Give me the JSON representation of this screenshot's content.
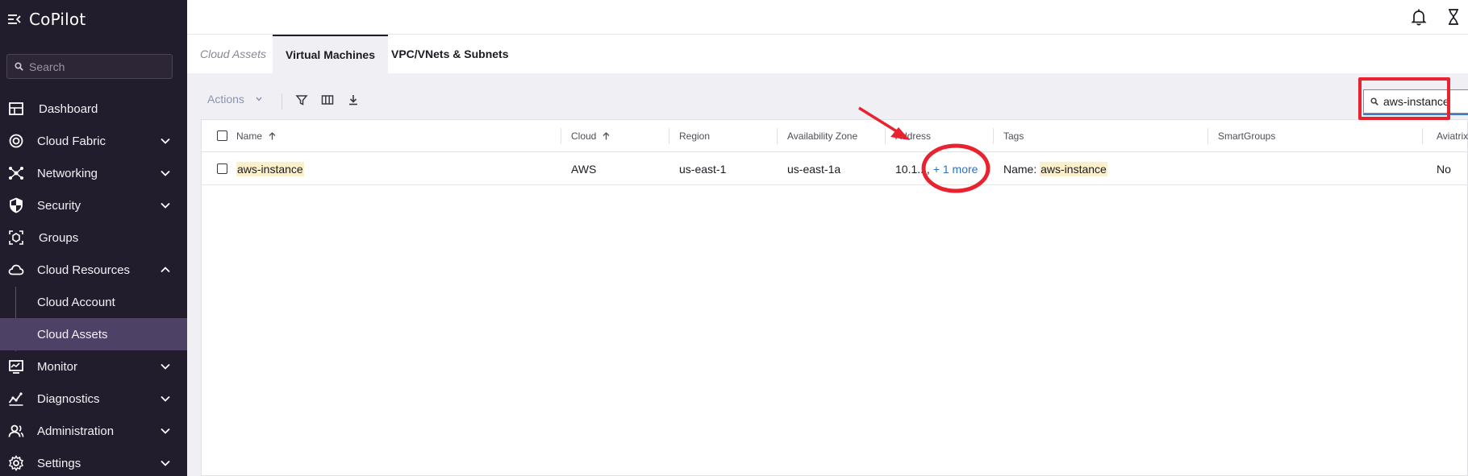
{
  "app": {
    "title": "CoPilot"
  },
  "sidebar": {
    "search_placeholder": "Search",
    "items": [
      {
        "label": "Dashboard",
        "icon": "dashboard-icon"
      },
      {
        "label": "Cloud Fabric",
        "icon": "cloud-fabric-icon",
        "expanded": false
      },
      {
        "label": "Networking",
        "icon": "networking-icon",
        "expanded": false
      },
      {
        "label": "Security",
        "icon": "shield-icon",
        "expanded": false
      },
      {
        "label": "Groups",
        "icon": "groups-icon"
      },
      {
        "label": "Cloud Resources",
        "icon": "cloud-icon",
        "expanded": true
      },
      {
        "label": "Monitor",
        "icon": "monitor-icon",
        "expanded": false
      },
      {
        "label": "Diagnostics",
        "icon": "diagnostics-icon",
        "expanded": false
      },
      {
        "label": "Administration",
        "icon": "administration-icon",
        "expanded": false
      },
      {
        "label": "Settings",
        "icon": "gear-icon",
        "expanded": false
      }
    ],
    "subitems": [
      {
        "label": "Cloud Account",
        "active": false
      },
      {
        "label": "Cloud Assets",
        "active": true
      }
    ]
  },
  "tabs": [
    {
      "label": "Cloud Assets",
      "state": "inactive"
    },
    {
      "label": "Virtual Machines",
      "state": "active"
    },
    {
      "label": "VPC/VNets & Subnets",
      "state": "normal"
    }
  ],
  "toolbar": {
    "actions_label": "Actions",
    "search_value": "aws-instance"
  },
  "table": {
    "columns": [
      "Name",
      "Cloud",
      "Region",
      "Availability Zone",
      "Address",
      "Tags",
      "SmartGroups",
      "Aviatrix"
    ],
    "rows": [
      {
        "name": "aws-instance",
        "cloud": "AWS",
        "region": "us-east-1",
        "az": "us-east-1a",
        "address": "10.1...",
        "address_sep": ",",
        "address_more": "+ 1 more",
        "tag_key": "Name:",
        "tag_value": "aws-instance",
        "smartgroups": "",
        "aviatrix": "No"
      }
    ]
  },
  "colors": {
    "sidebar_bg": "#221d2c",
    "active_sub_bg": "#4d4266",
    "annotation": "#e8222e",
    "link": "#2f6fc1",
    "highlight": "#fbf0c9"
  }
}
